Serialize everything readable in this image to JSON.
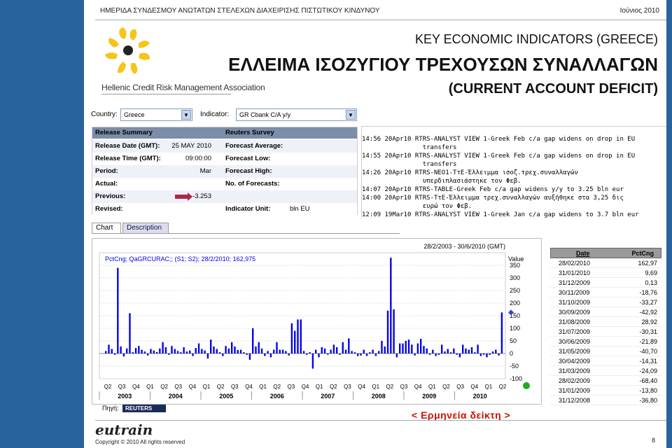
{
  "header": {
    "event_title": "ΗΜΕΡΙΔΑ ΣΥΝΔΕΣΜΟΥ ΑΝΩΤΑΤΩΝ ΣΤΕΛΕΧΩΝ ΔΙΑΧΕΙΡΙΣΗΣ ΠΙΣΤΩΤΙΚΟΥ ΚΙΝΔΥΝΟΥ",
    "date": "Ιούνιος 2010"
  },
  "logo": {
    "text": "Hellenic Credit Risk Management Association",
    "color": "#f5c518"
  },
  "titles": {
    "line1": "KEY ECONOMIC INDICATORS (GREECE)",
    "line2": "ΕΛΛΕΙΜΑ ΙΣΟΖΥΓΙΟΥ ΤΡΕΧΟΥΣΩΝ ΣΥΝΑΛΛΑΓΩΝ",
    "line3": "(CURRENT ACCOUNT DEFICIT)"
  },
  "controls": {
    "country_label": "Country:",
    "country_value": "Greece",
    "indicator_label": "Indicator:",
    "indicator_value": "GR Cbank C/A y/y"
  },
  "release": {
    "summary_header": "Release Summary",
    "survey_header": "Reuters Survey",
    "rows": [
      {
        "k": "Release Date (GMT):",
        "v": "25 MAY 2010",
        "k2": "Forecast Average:",
        "v2": ""
      },
      {
        "k": "Release Time (GMT):",
        "v": "09:00:00",
        "k2": "Forecast Low:",
        "v2": ""
      },
      {
        "k": "Period:",
        "v": "Mar",
        "k2": "Forecast High:",
        "v2": ""
      },
      {
        "k": "Actual:",
        "v": "",
        "k2": "No. of Forecasts:",
        "v2": ""
      },
      {
        "k": "Previous:",
        "v": "-3.253",
        "k2": "",
        "v2": ""
      },
      {
        "k": "Revised:",
        "v": "",
        "k2": "Indicator Unit:",
        "v2": "bln EU"
      }
    ]
  },
  "news": [
    "14:56 20Apr10 RTRS-ANALYST VIEW 1-Greek Feb c/a gap widens on drop in EU",
    "                transfers",
    "14:55 20Apr10 RTRS-ANALYST VIEW 1-Greek Feb c/a gap widens on drop in EU",
    "                transfers",
    "14:26 20Apr10 RTRS-ΝΕΟ1-ΤτΕ-Έλλειμμα ισοζ.τρεχ.συναλλαγών",
    "                υπερδιπλασιάστηκε τον Φεβ.",
    "14:07 20Apr10 RTRS-TABLE-Greek Feb c/a gap widens y/y to 3.25 bln eur",
    "14:00 20Apr10 RTRS-ΤτΕ-Έλλειμμα τρεχ.συναλλαγών αυξήθηκε στα 3,25 δις",
    "                ευρώ τον Φεβ.",
    "12:09 19Mar10 RTRS-ANALYST VIEW 1-Greek Jan c/a gap widens to 3.7 bln eur"
  ],
  "tabs": {
    "chart": "Chart",
    "description": "Description"
  },
  "chart_data": {
    "type": "bar",
    "title": "28/2/2003 - 30/6/2010 (GMT)",
    "series_label": "PctCng; QaGRCURAC;; (S1; S2); 28/2/2010; 162,975",
    "ylabel": "Value",
    "ylim": [
      -100,
      400
    ],
    "y_ticks": [
      -100,
      -50,
      0,
      50,
      100,
      150,
      200,
      250,
      300,
      350
    ],
    "quarter_ticks": [
      "Q2",
      "Q3",
      "Q4",
      "Q1",
      "Q2",
      "Q3",
      "Q4",
      "Q1",
      "Q2",
      "Q3",
      "Q4",
      "Q1",
      "Q2",
      "Q3",
      "Q4",
      "Q1",
      "Q2",
      "Q3",
      "Q4",
      "Q1",
      "Q2",
      "Q3",
      "Q4",
      "Q1",
      "Q2",
      "Q3",
      "Q4",
      "Q1",
      "Q2"
    ],
    "year_labels": [
      "2003",
      "2004",
      "2005",
      "2006",
      "2007",
      "2008",
      "2009",
      "2010"
    ],
    "values": [
      10,
      35,
      18,
      -5,
      340,
      28,
      -12,
      20,
      160,
      5,
      22,
      30,
      15,
      8,
      -8,
      18,
      12,
      6,
      20,
      45,
      25,
      -5,
      30,
      18,
      10,
      5,
      25,
      8,
      12,
      -10,
      22,
      40,
      18,
      12,
      -20,
      55,
      28,
      18,
      5,
      -10,
      30,
      20,
      45,
      28,
      14,
      15,
      5,
      -5,
      -25,
      100,
      28,
      45,
      20,
      -10,
      10,
      -15,
      15,
      45,
      15,
      15,
      10,
      -8,
      120,
      90,
      135,
      135,
      10,
      -5,
      5,
      -60,
      15,
      -15,
      25,
      20,
      -5,
      15,
      35,
      25,
      -5,
      45,
      15,
      60,
      10,
      5,
      -10,
      -8,
      15,
      -10,
      5,
      15,
      -10,
      10,
      50,
      28,
      170,
      380,
      175,
      -15,
      40,
      40,
      50,
      55,
      35,
      -8,
      40,
      58,
      30,
      20,
      -5,
      15,
      -10,
      -5,
      35,
      8,
      18,
      5,
      20,
      -5,
      -15,
      35,
      20,
      15,
      25,
      5,
      35,
      -10,
      -5,
      -15,
      -5,
      8,
      15,
      -8,
      163
    ],
    "grid": true
  },
  "table": {
    "headers": {
      "date": "Date",
      "pct": "PctCng"
    },
    "rows": [
      {
        "date": "28/02/2010",
        "pct": "162,97"
      },
      {
        "date": "31/01/2010",
        "pct": "9,69"
      },
      {
        "date": "31/12/2009",
        "pct": "0,13"
      },
      {
        "date": "30/11/2009",
        "pct": "-18,76"
      },
      {
        "date": "31/10/2009",
        "pct": "-33,27"
      },
      {
        "date": "30/09/2009",
        "pct": "-42,92"
      },
      {
        "date": "31/08/2009",
        "pct": "28,92"
      },
      {
        "date": "31/07/2009",
        "pct": "-30,31"
      },
      {
        "date": "30/06/2009",
        "pct": "-21,89"
      },
      {
        "date": "31/05/2009",
        "pct": "-40,70"
      },
      {
        "date": "30/04/2009",
        "pct": "-14,31"
      },
      {
        "date": "31/03/2009",
        "pct": "-24,09"
      },
      {
        "date": "28/02/2009",
        "pct": "-68,40"
      },
      {
        "date": "31/01/2009",
        "pct": "-13,80"
      },
      {
        "date": "31/12/2008",
        "pct": "-36,80"
      }
    ]
  },
  "source": {
    "label": "Πηγή:",
    "provider": "REUTERS"
  },
  "interpretation": "< Ερμηνεία δείκτη >",
  "footer": {
    "brand": "eutrain",
    "copyright": "Copyright © 2010 All rights reserved",
    "page": "8"
  },
  "colors": {
    "sidebar": "#28649b",
    "bars": "#0000ee",
    "accent_red": "#cc1100"
  }
}
